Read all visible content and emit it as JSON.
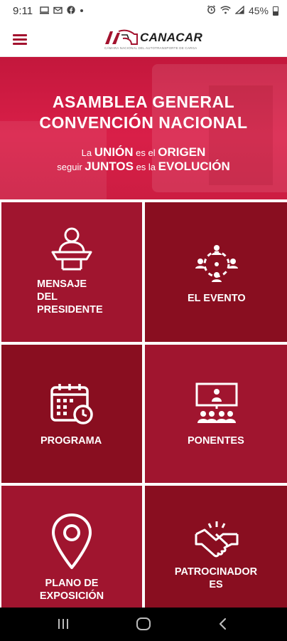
{
  "status_bar": {
    "time": "9:11",
    "notification_icons": [
      "screen-icon",
      "mail-icon",
      "facebook-icon",
      "dot-icon"
    ],
    "battery": "45%"
  },
  "app_header": {
    "logo_text": "CANACAR",
    "logo_subtitle": "CÁMARA NACIONAL DEL AUTOTRANSPORTE DE CARGA"
  },
  "hero": {
    "title_line1": "ASAMBLEA GENERAL",
    "title_line2": "CONVENCIÓN NACIONAL",
    "tagline1": {
      "a": "La",
      "b": "UNIÓN",
      "c": "es el",
      "d": "ORIGEN"
    },
    "tagline2": {
      "a": "seguir",
      "b": "JUNTOS",
      "c": "es la",
      "d": "EVOLUCIÓN"
    }
  },
  "menu": {
    "mensaje": {
      "line1": "MENSAJE",
      "line2": "DEL",
      "line3": "PRESIDENTE",
      "icon": "presenter-podium-icon"
    },
    "evento": {
      "label": "EL EVENTO",
      "icon": "network-people-icon"
    },
    "programa": {
      "label": "PROGRAMA",
      "icon": "calendar-clock-icon"
    },
    "ponentes": {
      "label": "PONENTES",
      "icon": "speaker-audience-icon"
    },
    "plano": {
      "line1": "PLANO DE",
      "line2": "EXPOSICIÓN",
      "icon": "map-pin-icon"
    },
    "patrocinadores": {
      "line1": "PATROCINADOR",
      "line2": "ES",
      "icon": "handshake-icon"
    }
  },
  "colors": {
    "brand_red": "#a3122e",
    "tile_light": "#a0152f",
    "tile_dark": "#890e20",
    "hero_red": "#d91f48"
  }
}
